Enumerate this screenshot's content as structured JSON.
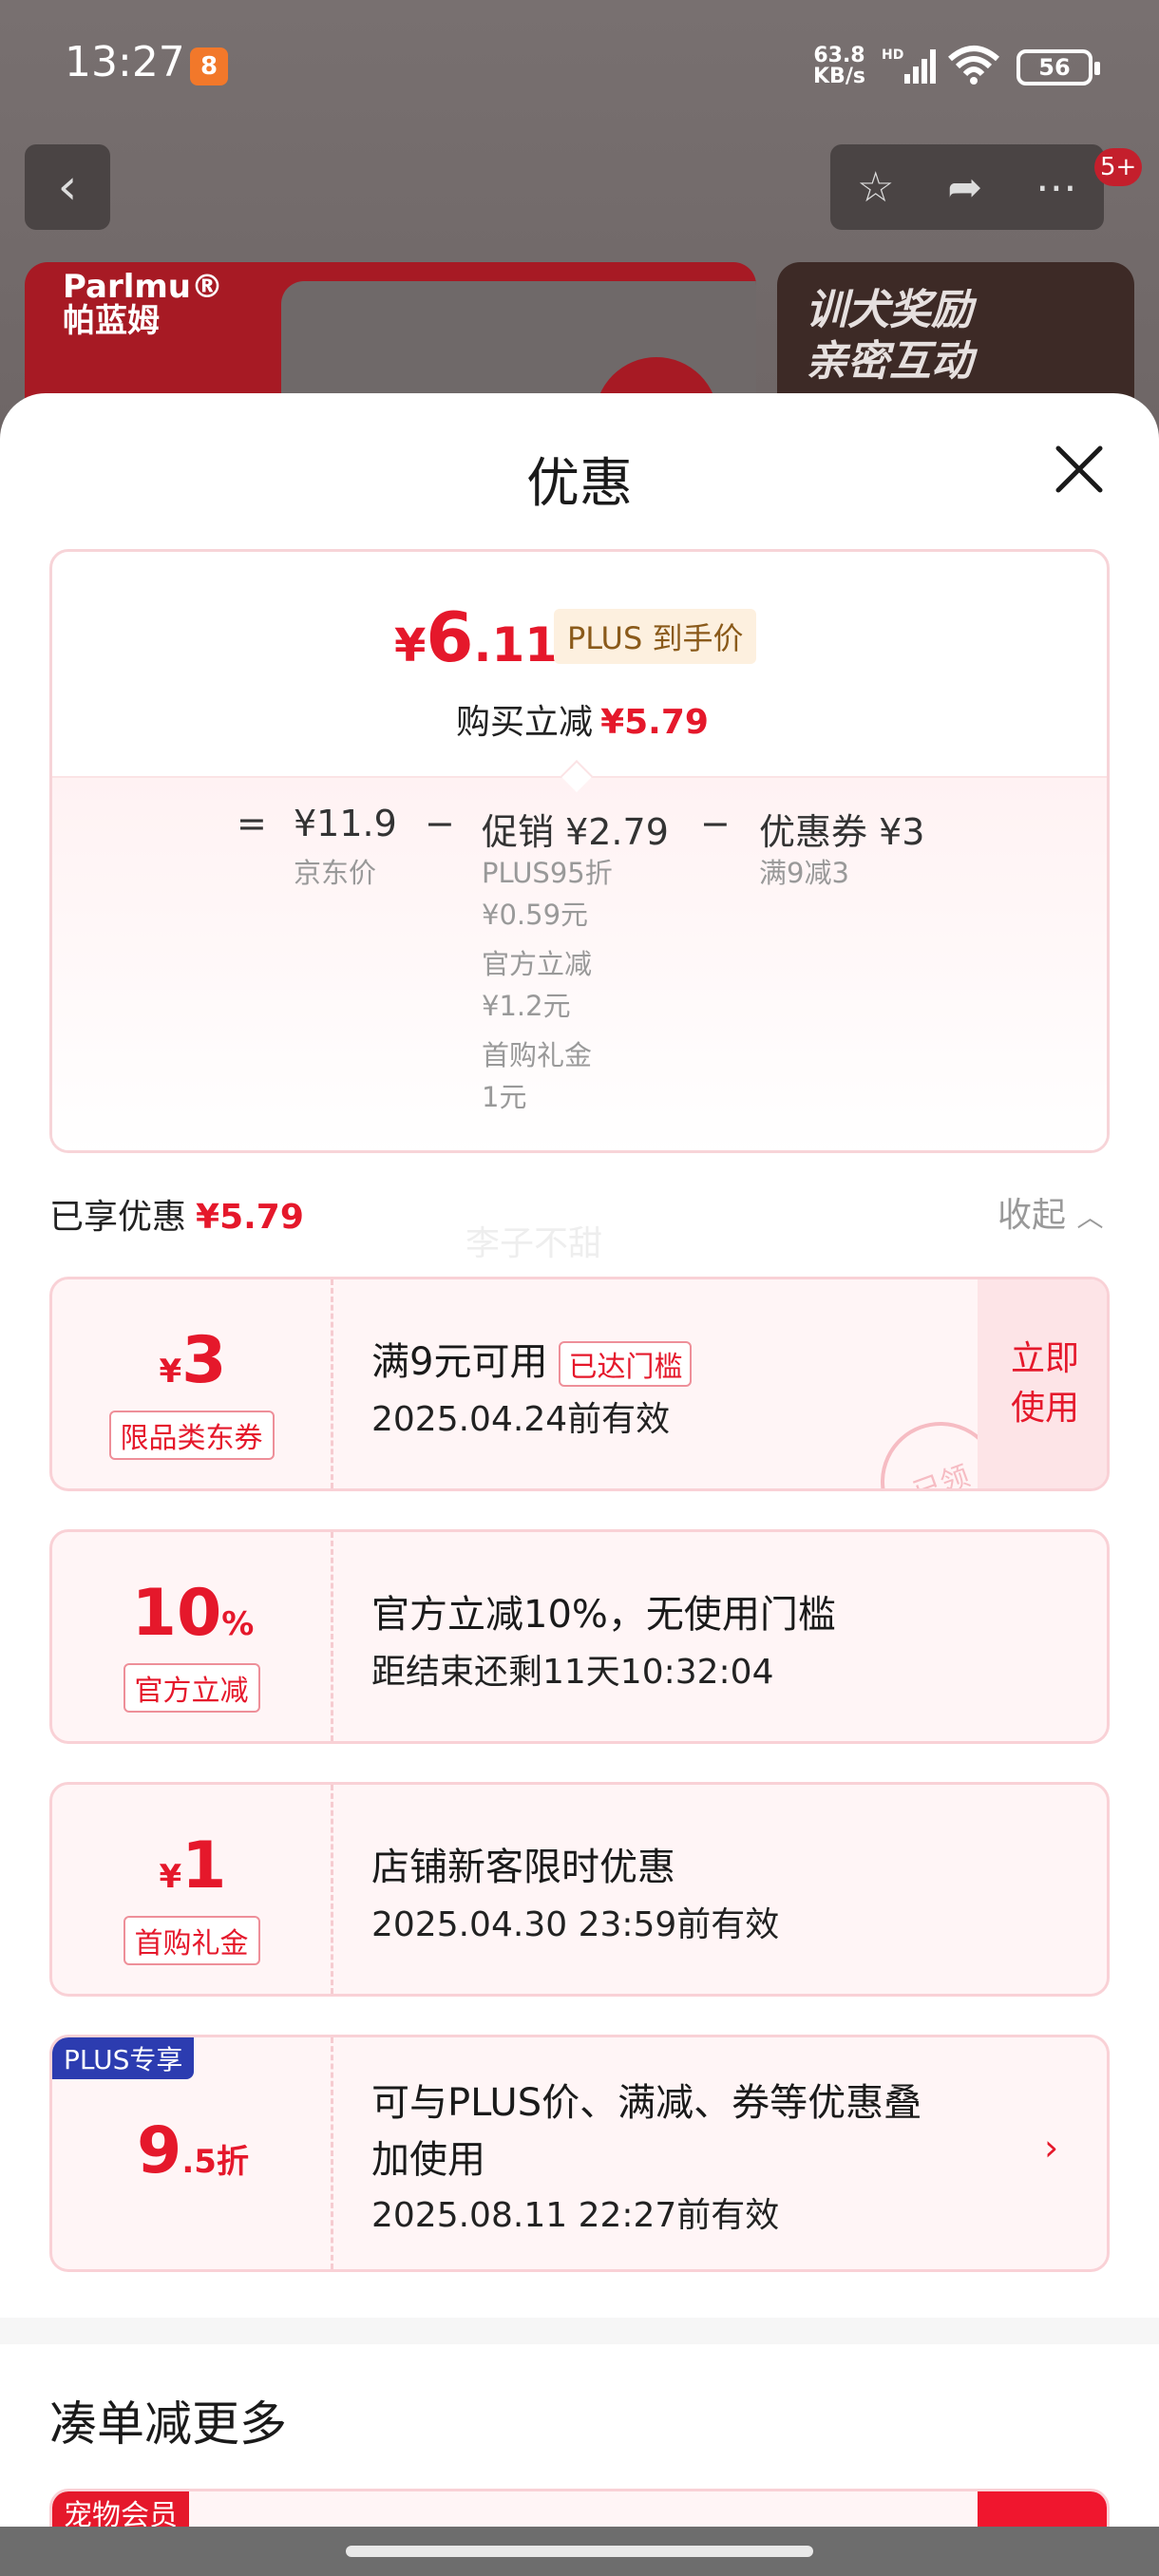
{
  "status_bar": {
    "time": "13:27",
    "app_badge": "8",
    "net_speed": "63.8",
    "net_unit": "KB/s",
    "net_type": "HD",
    "battery": "56"
  },
  "background": {
    "nav_badge": "5+",
    "brand": "Parlmu®\n帕蓝姆",
    "banner_text": "训犬奖励\n亲密互动"
  },
  "sheet": {
    "title": "优惠",
    "price": {
      "currency": "¥",
      "integer": "6",
      "decimal": ".11",
      "plus_tag": "PLUS 到手价",
      "buy_reduce_label": "购买立减",
      "buy_reduce_value": "¥5.79"
    },
    "breakdown": {
      "eq": "=",
      "jd_price": "¥11.9",
      "jd_price_label": "京东价",
      "minus1": "−",
      "promo": "促销 ¥2.79",
      "promo_items": [
        "PLUS95折",
        "¥0.59元",
        "官方立减",
        "¥1.2元",
        "首购礼金",
        "1元"
      ],
      "minus2": "−",
      "coupon": "优惠券 ¥3",
      "coupon_sub": "满9减3"
    },
    "enjoyed_label": "已享优惠",
    "enjoyed_value": "¥5.79",
    "collapse_label": "收起",
    "watermark": "李子不甜",
    "coupons": [
      {
        "small": "¥",
        "big": "3",
        "tag": "限品类东券",
        "title": "满9元可用",
        "reach_tag": "已达门槛",
        "sub": "2025.04.24前有效",
        "action": "立即\n使用",
        "stamp": "已领"
      },
      {
        "big": "10",
        "small": "%",
        "tag": "官方立减",
        "title": "官方立减10%，无使用门槛",
        "sub": "距结束还剩11天10:32:04"
      },
      {
        "small": "¥",
        "big": "1",
        "tag": "首购礼金",
        "title": "店铺新客限时优惠",
        "sub": "2025.04.30 23:59前有效"
      },
      {
        "corner": "PLUS专享",
        "big": "9",
        "small": ".5折",
        "title": "可与PLUS价、满减、券等优惠叠",
        "title2": "加使用",
        "sub": "2025.08.11 22:27前有效",
        "chevron": "›"
      }
    ],
    "more_title": "凑单减更多",
    "pet_tag": "宠物会员"
  }
}
